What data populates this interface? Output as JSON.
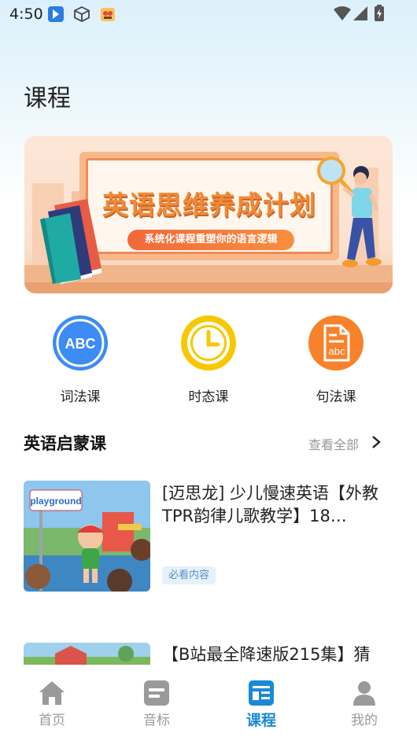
{
  "status_bar": {
    "time": "4:50",
    "icons": [
      "app-notification-icon",
      "box-icon",
      "game-icon"
    ],
    "right_icons": [
      "wifi-icon",
      "signal-icon",
      "battery-charging-icon"
    ]
  },
  "page": {
    "title": "课程"
  },
  "banner": {
    "title": "英语思维养成计划",
    "subtitle": "系统化课程重塑你的语言逻辑"
  },
  "categories": [
    {
      "label": "词法课",
      "icon": "abc-icon",
      "color": "#3d8bf5"
    },
    {
      "label": "时态课",
      "icon": "clock-icon",
      "color": "#f7c800"
    },
    {
      "label": "句法课",
      "icon": "abc-document-icon",
      "color": "#f7822b"
    }
  ],
  "section": {
    "title": "英语启蒙课",
    "view_all": "查看全部"
  },
  "courses": [
    {
      "title": "[迈思龙] 少儿慢速英语【外教TPR韵律儿歌教学】18…",
      "tag": "必看内容",
      "thumb_text": "playground"
    },
    {
      "title": "【B站最全降速版215集】猜"
    }
  ],
  "bottom_nav": [
    {
      "label": "首页",
      "icon": "home-icon",
      "active": false
    },
    {
      "label": "音标",
      "icon": "phonetic-icon",
      "active": false
    },
    {
      "label": "课程",
      "icon": "course-icon",
      "active": true
    },
    {
      "label": "我的",
      "icon": "profile-icon",
      "active": false
    }
  ],
  "colors": {
    "accent": "#1a8ad8",
    "banner_orange": "#f08a34",
    "tag_bg": "#e7f1fb",
    "tag_text": "#5a8fc8"
  }
}
